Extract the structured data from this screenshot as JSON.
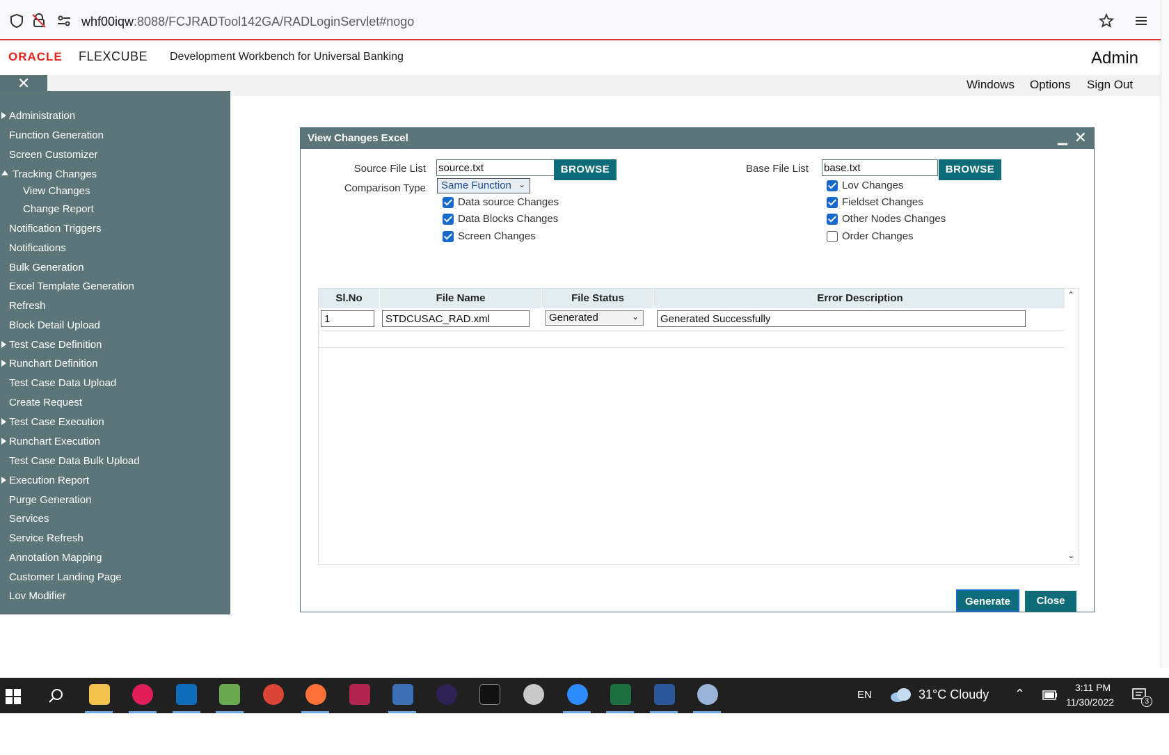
{
  "browser": {
    "url_host": "whf00iqw",
    "url_path": ":8088/FCJRADTool142GA/RADLoginServlet#nogo"
  },
  "header": {
    "oracle": "ORACLE",
    "product": "FLEXCUBE",
    "app_title": "Development Workbench for Universal Banking",
    "user": "Admin"
  },
  "topmenu": {
    "windows": "Windows",
    "options": "Options",
    "signout": "Sign Out",
    "close_sidebar": "✕"
  },
  "sidebar": {
    "items": [
      {
        "label": "Administration"
      },
      {
        "label": "Function Generation"
      },
      {
        "label": "Screen Customizer"
      },
      {
        "label": "Tracking Changes"
      },
      {
        "label": "View Changes"
      },
      {
        "label": "Change Report"
      },
      {
        "label": "Notification Triggers"
      },
      {
        "label": "Notifications"
      },
      {
        "label": "Bulk Generation"
      },
      {
        "label": "Excel Template Generation"
      },
      {
        "label": "Refresh"
      },
      {
        "label": "Block Detail Upload"
      },
      {
        "label": "Test Case Definition"
      },
      {
        "label": "Runchart Definition"
      },
      {
        "label": "Test Case Data Upload"
      },
      {
        "label": "Create Request"
      },
      {
        "label": "Test Case Execution"
      },
      {
        "label": "Runchart Execution"
      },
      {
        "label": "Test Case Data Bulk Upload"
      },
      {
        "label": "Execution Report"
      },
      {
        "label": "Purge Generation"
      },
      {
        "label": "Services"
      },
      {
        "label": "Service Refresh"
      },
      {
        "label": "Annotation Mapping"
      },
      {
        "label": "Customer Landing Page"
      },
      {
        "label": "Lov Modifier"
      }
    ]
  },
  "dialog": {
    "title": "View Changes Excel",
    "source_label": "Source File List",
    "source_value": "source.txt",
    "base_label": "Base File List",
    "base_value": "base.txt",
    "browse": "BROWSE",
    "comparison_label": "Comparison Type",
    "comparison_value": "Same Function",
    "left_checks": [
      {
        "label": "Data source Changes",
        "checked": true
      },
      {
        "label": "Data Blocks Changes",
        "checked": true
      },
      {
        "label": "Screen Changes",
        "checked": true
      }
    ],
    "right_checks": [
      {
        "label": "Lov Changes",
        "checked": true
      },
      {
        "label": "Fieldset Changes",
        "checked": true
      },
      {
        "label": "Other Nodes Changes",
        "checked": true
      },
      {
        "label": "Order Changes",
        "checked": false
      }
    ],
    "grid": {
      "headers": [
        "Sl.No",
        "File Name",
        "File Status",
        "Error Description"
      ],
      "rows": [
        {
          "slno": "1",
          "file_name": "STDCUSAC_RAD.xml",
          "status": "Generated",
          "error": "Generated Successfully"
        }
      ]
    },
    "generate": "Generate",
    "close": "Close"
  },
  "taskbar": {
    "lang": "EN",
    "weather": "31°C  Cloudy",
    "time": "3:11 PM",
    "date": "11/30/2022",
    "notif_count": "3"
  }
}
